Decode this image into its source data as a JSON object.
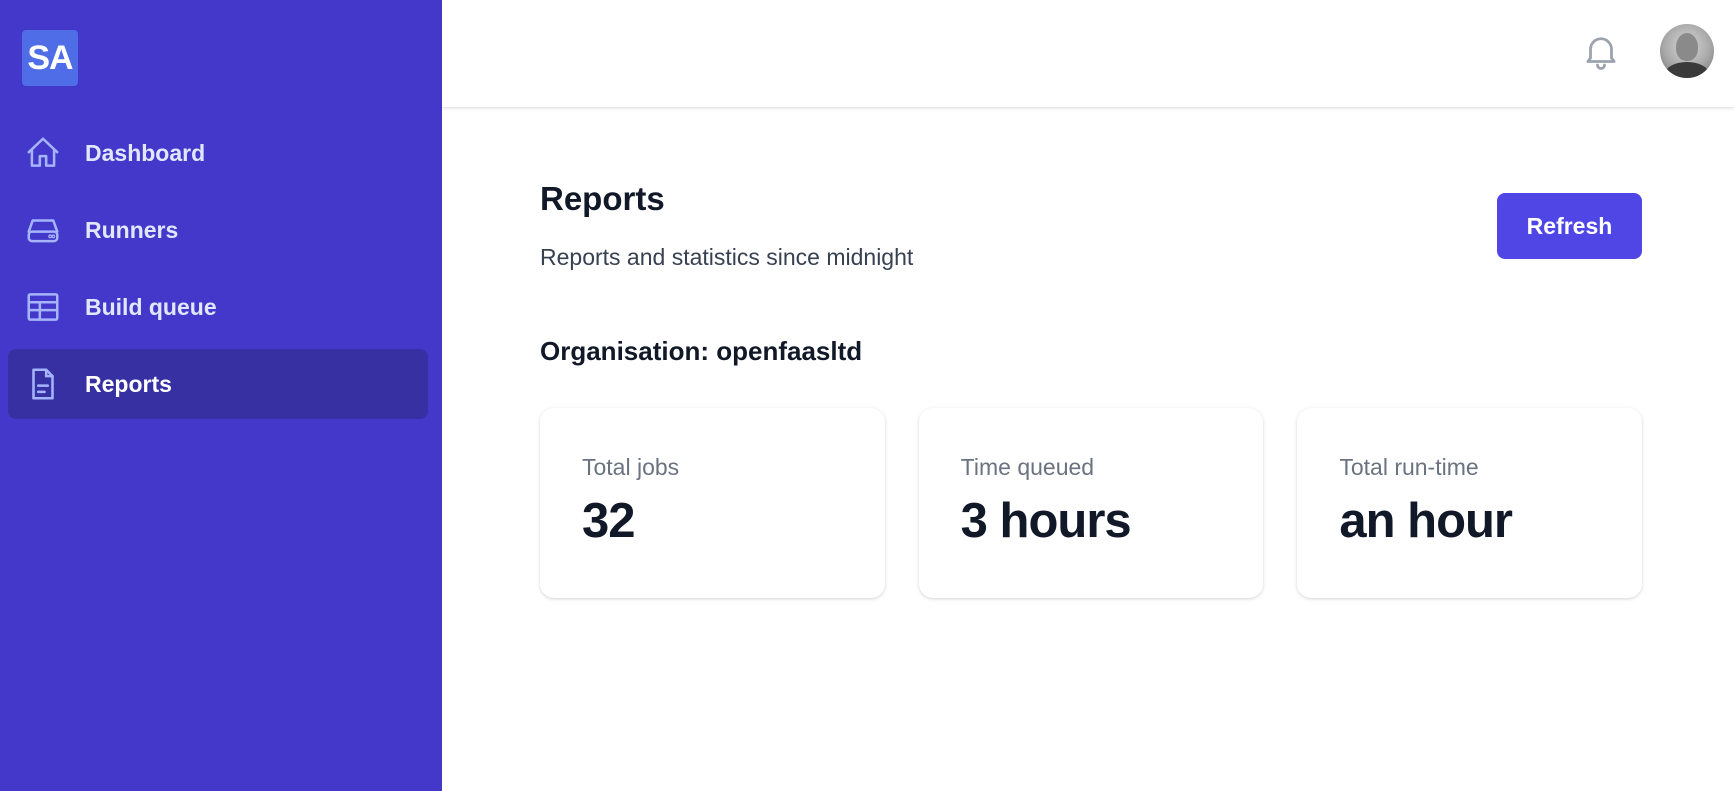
{
  "logo": {
    "text": "SA"
  },
  "sidebar": {
    "items": [
      {
        "label": "Dashboard",
        "icon": "home-icon",
        "active": false
      },
      {
        "label": "Runners",
        "icon": "server-icon",
        "active": false
      },
      {
        "label": "Build queue",
        "icon": "table-icon",
        "active": false
      },
      {
        "label": "Reports",
        "icon": "document-icon",
        "active": true
      }
    ]
  },
  "topbar": {
    "notification_icon": "bell-icon",
    "avatar_icon": "user-avatar"
  },
  "page": {
    "title": "Reports",
    "subtitle": "Reports and statistics since midnight",
    "refresh_label": "Refresh",
    "organisation": "Organisation: openfaasltd"
  },
  "stats": [
    {
      "label": "Total jobs",
      "value": "32"
    },
    {
      "label": "Time queued",
      "value": "3 hours"
    },
    {
      "label": "Total run-time",
      "value": "an hour"
    }
  ],
  "colors": {
    "sidebar_bg": "#4338ca",
    "active_item_bg": "#3730a3",
    "primary_button": "#4f46e5",
    "logo_bg": "#4f6de6"
  }
}
